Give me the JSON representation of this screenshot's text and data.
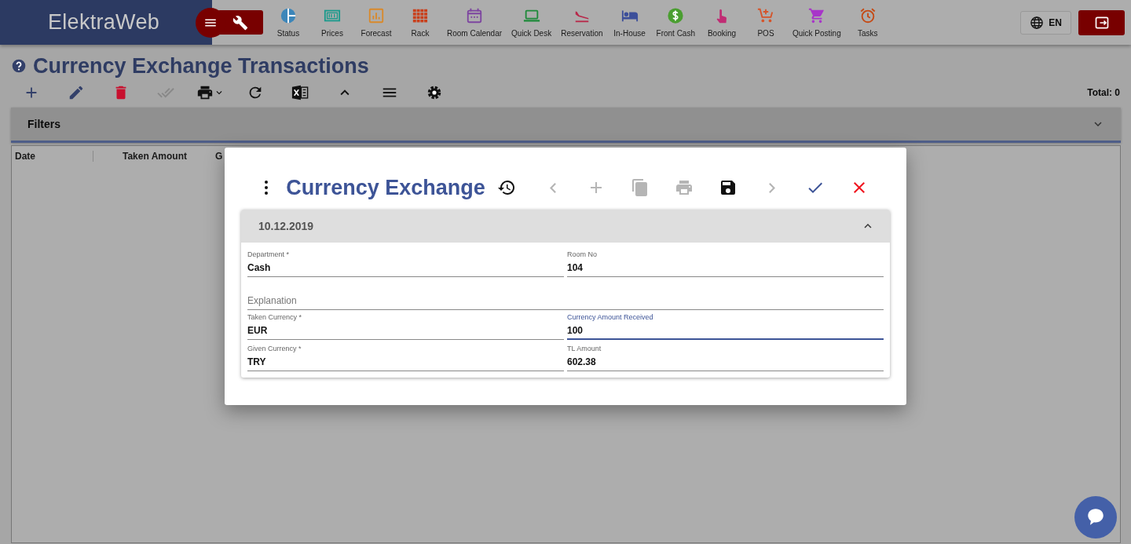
{
  "header": {
    "logo": "ElektraWeb",
    "nav": [
      {
        "label": "Status",
        "color": "#3d86b9"
      },
      {
        "label": "Prices",
        "color": "#1a9a8c"
      },
      {
        "label": "Forecast",
        "color": "#d9892a"
      },
      {
        "label": "Rack",
        "color": "#c9401c"
      },
      {
        "label": "Room Calendar",
        "color": "#7d45a0"
      },
      {
        "label": "Quick Desk",
        "color": "#1e8a3a"
      },
      {
        "label": "Reservation",
        "color": "#b8284a"
      },
      {
        "label": "In-House",
        "color": "#3c4f9a"
      },
      {
        "label": "Front Cash",
        "color": "#4a9e30"
      },
      {
        "label": "Booking",
        "color": "#c02c74"
      },
      {
        "label": "POS",
        "color": "#d5542a"
      },
      {
        "label": "Quick Posting",
        "color": "#a835c9"
      },
      {
        "label": "Tasks",
        "color": "#c54a14"
      }
    ],
    "language": "EN"
  },
  "page": {
    "title": "Currency Exchange Transactions",
    "total": "Total: 0",
    "toolbar": [
      {
        "disabled": false
      },
      {
        "disabled": false
      },
      {
        "disabled": false
      },
      {
        "disabled": true
      },
      {
        "disabled": false
      },
      {
        "disabled": false
      },
      {
        "disabled": false
      },
      {
        "disabled": false
      },
      {
        "disabled": false
      },
      {
        "disabled": false
      }
    ],
    "filters": {
      "label": "Filters",
      "expanded": false
    },
    "table": {
      "columns": [
        "Date",
        "Taken Amount",
        "G"
      ]
    }
  },
  "dialog": {
    "title": "Currency Exchange",
    "toolbar": [
      {
        "disabled": false
      },
      {
        "disabled": true
      },
      {
        "disabled": true
      },
      {
        "disabled": true
      },
      {
        "disabled": true
      },
      {
        "disabled": false
      },
      {
        "disabled": true
      },
      {
        "disabled": false
      },
      {
        "disabled": false
      }
    ],
    "section": {
      "title": "10.12.2019",
      "expanded": true
    },
    "fields": [
      {
        "label": "Department *",
        "value": "Cash",
        "focused": false
      },
      {
        "label": "Room No",
        "value": "104",
        "focused": false
      },
      {
        "placeholder": "Explanation",
        "focused": false
      },
      {
        "label": "Taken Currency *",
        "value": "EUR",
        "focused": false
      },
      {
        "label": "Currency Amount Received",
        "value": "100",
        "focused": true
      },
      {
        "label": "Given Currency *",
        "value": "TRY",
        "focused": false
      },
      {
        "label": "TL Amount",
        "value": "602.38",
        "focused": false
      }
    ]
  }
}
